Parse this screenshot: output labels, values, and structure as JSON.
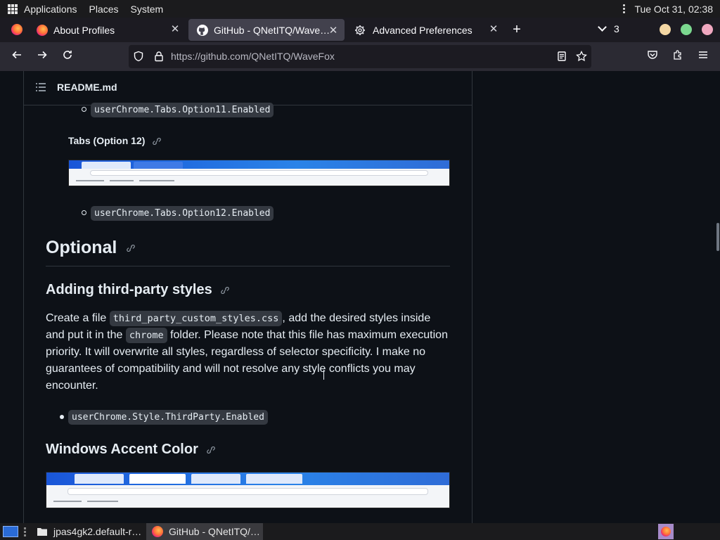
{
  "top_panel": {
    "menus": [
      "Applications",
      "Places",
      "System"
    ],
    "clock": "Tue Oct 31, 02:38"
  },
  "tabs": [
    {
      "title": "About Profiles"
    },
    {
      "title": "GitHub - QNetITQ/Wave…"
    },
    {
      "title": "Advanced Preferences"
    }
  ],
  "tab_count": "3",
  "close_glyph": "✕",
  "window_dots": [
    "#f4d7a4",
    "#7bd88f",
    "#f0a8c0"
  ],
  "url": "https://github.com/QNetITQ/WaveFox",
  "readme": {
    "file_name": "README.md",
    "items": {
      "option11_code": "userChrome.Tabs.Option11.Enabled",
      "option12_heading": "Tabs (Option 12)",
      "option12_code": "userChrome.Tabs.Option12.Enabled",
      "optional_heading": "Optional",
      "third_party_heading": "Adding third-party styles",
      "para": {
        "t1": "Create a file ",
        "c1": "third_party_custom_styles.css",
        "t2": ", add the desired styles inside",
        "t3": "and put it in the ",
        "c2": "chrome",
        "t4": " folder. Please note that this file has maximum execution",
        "t5": "priority. It will overwrite all styles, regardless of selector specificity. I make no",
        "t6": "guarantees of compatibility and will not resolve any style conflicts you may",
        "t7": "encounter."
      },
      "third_party_code": "userChrome.Style.ThirdParty.Enabled",
      "accent_heading": "Windows Accent Color"
    }
  },
  "taskbar": {
    "items": [
      "jpas4gk2.default-r…",
      "GitHub - QNetITQ/…"
    ]
  },
  "colors": {
    "accent": "#2f81f7"
  }
}
